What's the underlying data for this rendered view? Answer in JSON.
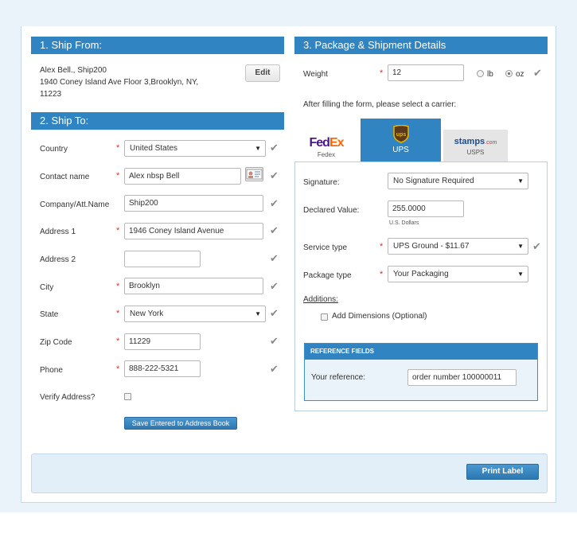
{
  "ship_from": {
    "title": "1. Ship From:",
    "address_line1": "Alex Bell., Ship200",
    "address_line2": "1940 Coney Island Ave Floor 3,Brooklyn, NY,",
    "address_line3": "11223",
    "edit_label": "Edit"
  },
  "ship_to": {
    "title": "2. Ship To:",
    "country_label": "Country",
    "country_value": "United States",
    "contact_label": "Contact name",
    "contact_value": "Alex nbsp Bell",
    "company_label": "Company/Att.Name",
    "company_value": "Ship200",
    "address1_label": "Address 1",
    "address1_value": "1946 Coney Island Avenue",
    "address2_label": "Address 2",
    "address2_value": "",
    "city_label": "City",
    "city_value": "Brooklyn",
    "state_label": "State",
    "state_value": "New York",
    "zip_label": "Zip Code",
    "zip_value": "11229",
    "phone_label": "Phone",
    "phone_value": "888-222-5321",
    "verify_label": "Verify Address?",
    "save_label": "Save Entered to Address Book"
  },
  "package": {
    "title": "3. Package & Shipment Details",
    "weight_label": "Weight",
    "weight_value": "12",
    "unit_lb": "lb",
    "unit_oz": "oz",
    "selected_unit": "oz",
    "carrier_prompt": "After filling the form, please select a carrier:",
    "carriers": [
      {
        "name": "Fedex",
        "logo": "FedEx"
      },
      {
        "name": "UPS",
        "logo": "ups"
      },
      {
        "name": "USPS",
        "logo": "stamps.com"
      }
    ],
    "selected_carrier": "UPS",
    "signature_label": "Signature:",
    "signature_value": "No Signature Required",
    "declared_label": "Declared Value:",
    "declared_value": "255.0000",
    "declared_currency": "U.S. Dollars",
    "service_label": "Service type",
    "service_value": "UPS Ground - $11.67",
    "package_label": "Package type",
    "package_value": "Your Packaging",
    "additions_label": "Additions:",
    "dimensions_label": "Add Dimensions (Optional)",
    "reference_title": "REFERENCE FIELDS",
    "reference_label": "Your reference:",
    "reference_value": "order number 100000011"
  },
  "footer": {
    "print_label": "Print Label"
  },
  "colors": {
    "accent": "#2f84c1",
    "required": "#d9342b",
    "page_bg": "#eaf3fa"
  }
}
